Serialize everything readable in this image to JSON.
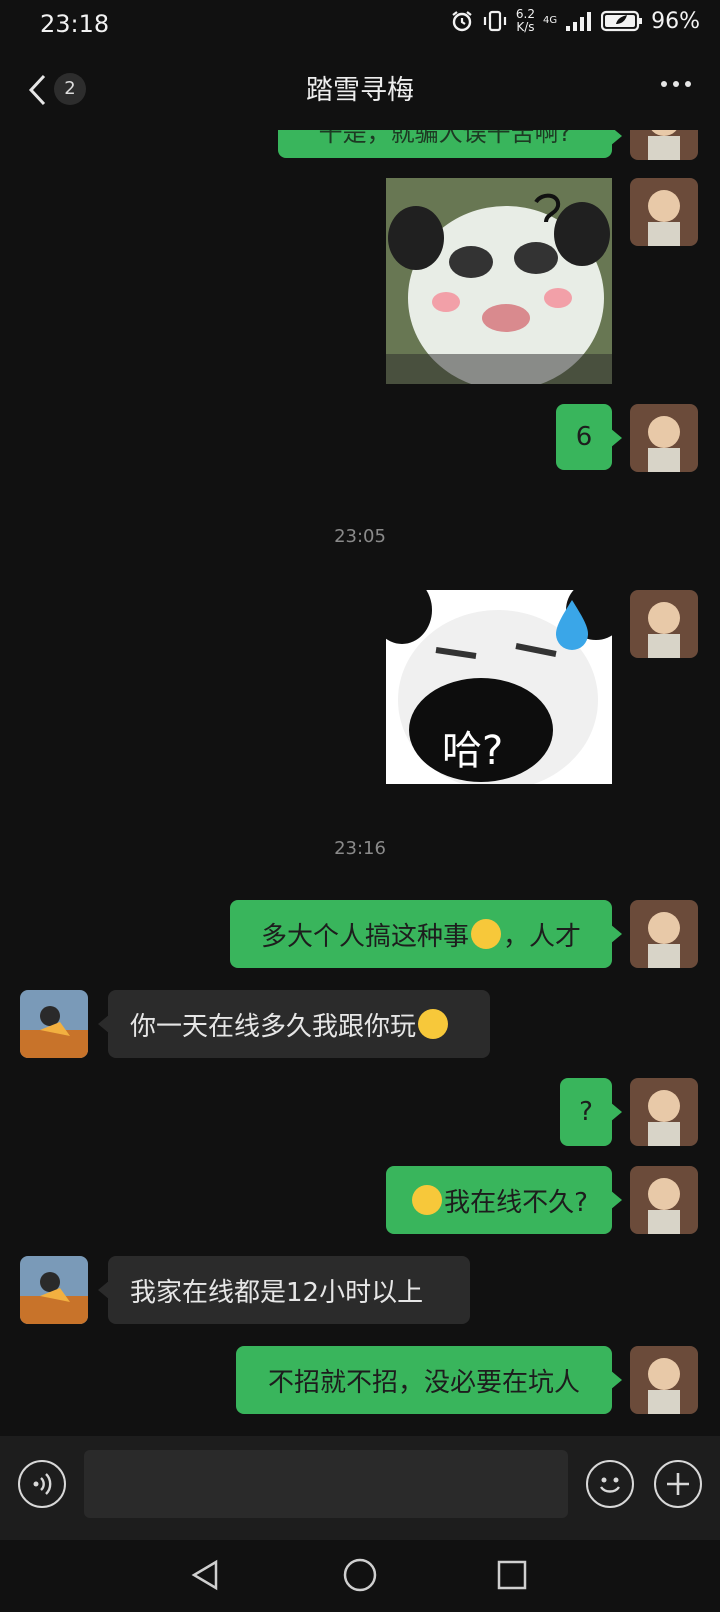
{
  "status": {
    "time": "23:18",
    "net_speed_value": "6.2",
    "net_speed_unit": "K/s",
    "network": "4G",
    "battery": "96%"
  },
  "header": {
    "title": "踏雪寻梅",
    "unread_count": "2"
  },
  "messages": {
    "partial_top": "干是，就骗人误干苦啊?",
    "m1_text": "6",
    "ts1": "23:05",
    "sticker2_text": "哈?",
    "ts2": "23:16",
    "m2_text_a": "多大个人搞这种事",
    "m2_text_b": "，人才",
    "m3_text": "你一天在线多久我跟你玩",
    "m4_text": "?",
    "m5_text": "我在线不久?",
    "m6_text": "我家在线都是12小时以上",
    "m7_text": "不招就不招，没必要在坑人"
  },
  "colors": {
    "me_bubble": "#39b55c",
    "other_bubble": "#2b2b2b",
    "background": "#111111"
  },
  "icons": [
    "back-icon",
    "more-icon",
    "voice-icon",
    "emoji-icon",
    "plus-icon",
    "nav-back-icon",
    "nav-home-icon",
    "nav-recents-icon"
  ]
}
